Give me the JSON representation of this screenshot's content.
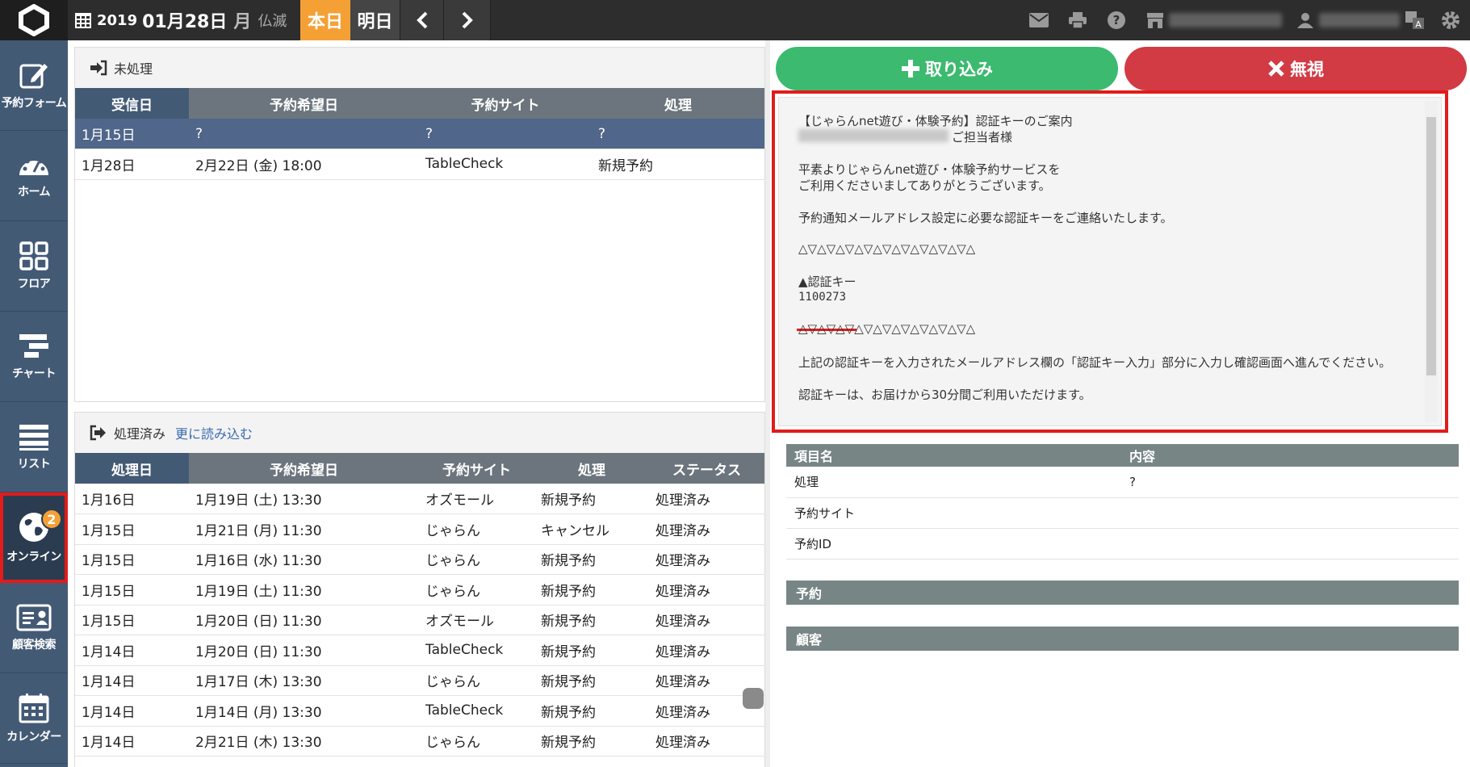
{
  "topbar": {
    "year": "2019",
    "month_day": "01月28日",
    "weekday": "月",
    "rokuyo": "仏滅",
    "today_label": "本日",
    "tomorrow_label": "明日",
    "icons": [
      "mail-icon",
      "print-icon",
      "help-icon",
      "store-icon",
      "user-icon",
      "translate-icon",
      "gear-icon"
    ]
  },
  "sidebar": {
    "items": [
      {
        "label": "予約フォーム",
        "icon": "edit-icon"
      },
      {
        "label": "ホーム",
        "icon": "dashboard-icon"
      },
      {
        "label": "フロア",
        "icon": "grid-icon"
      },
      {
        "label": "チャート",
        "icon": "chart-icon"
      },
      {
        "label": "リスト",
        "icon": "list-icon"
      },
      {
        "label": "オンライン",
        "icon": "globe-icon",
        "badge": "2"
      },
      {
        "label": "顧客検索",
        "icon": "customer-card-icon"
      },
      {
        "label": "カレンダー",
        "icon": "calendar-icon"
      }
    ]
  },
  "pending": {
    "title": "未処理",
    "columns": [
      "受信日",
      "予約希望日",
      "予約サイト",
      "処理"
    ],
    "rows": [
      [
        "1月15日",
        "?",
        "?",
        "?"
      ],
      [
        "1月28日",
        "2月22日 (金) 18:00",
        "TableCheck",
        "新規予約"
      ]
    ]
  },
  "processed": {
    "title": "処理済み",
    "more_label": "更に読み込む",
    "columns": [
      "処理日",
      "予約希望日",
      "予約サイト",
      "処理",
      "ステータス"
    ],
    "rows": [
      [
        "1月16日",
        "1月19日 (土) 13:30",
        "オズモール",
        "新規予約",
        "処理済み"
      ],
      [
        "1月15日",
        "1月21日 (月) 11:30",
        "じゃらん",
        "キャンセル",
        "処理済み"
      ],
      [
        "1月15日",
        "1月16日 (水) 11:30",
        "じゃらん",
        "新規予約",
        "処理済み"
      ],
      [
        "1月15日",
        "1月19日 (土) 11:30",
        "じゃらん",
        "新規予約",
        "処理済み"
      ],
      [
        "1月15日",
        "1月20日 (日) 11:30",
        "オズモール",
        "新規予約",
        "処理済み"
      ],
      [
        "1月14日",
        "1月20日 (日) 11:30",
        "TableCheck",
        "新規予約",
        "処理済み"
      ],
      [
        "1月14日",
        "1月17日 (木) 13:30",
        "じゃらん",
        "新規予約",
        "処理済み"
      ],
      [
        "1月14日",
        "1月14日 (月) 13:30",
        "TableCheck",
        "新規予約",
        "処理済み"
      ],
      [
        "1月14日",
        "2月21日 (木) 13:30",
        "じゃらん",
        "新規予約",
        "処理済み"
      ]
    ]
  },
  "actions": {
    "import_label": "取り込み",
    "ignore_label": "無視"
  },
  "mail": {
    "subject": "【じゃらんnet遊び・体験予約】認証キーのご案内",
    "greeting": "ご担当者様",
    "line1": "平素よりじゃらんnet遊び・体験予約サービスを",
    "line2": "ご利用くださいましてありがとうございます。",
    "line3": "予約通知メールアドレス設定に必要な認証キーをご連絡いたします。",
    "divider": "△▽△▽△▽△▽△▽△▽△▽△▽△▽△",
    "key_label": "▲認証キー",
    "key_value": "1100273",
    "line4": "上記の認証キーを入力されたメールアドレス欄の「認証キー入力」部分に入力し確認画面へ進んでください。",
    "line5": "認証キーは、お届けから30分間ご利用いただけます。"
  },
  "detail": {
    "columns": [
      "項目名",
      "内容"
    ],
    "rows": [
      [
        "処理",
        "?"
      ],
      [
        "予約サイト",
        ""
      ],
      [
        "予約ID",
        ""
      ]
    ],
    "section_reservation": "予約",
    "section_customer": "顧客"
  },
  "colors": {
    "sidebar": "#435a75",
    "today": "#f5a035",
    "import": "#3cba6f",
    "ignore": "#d23a44",
    "highlight": "#e21b1b"
  }
}
